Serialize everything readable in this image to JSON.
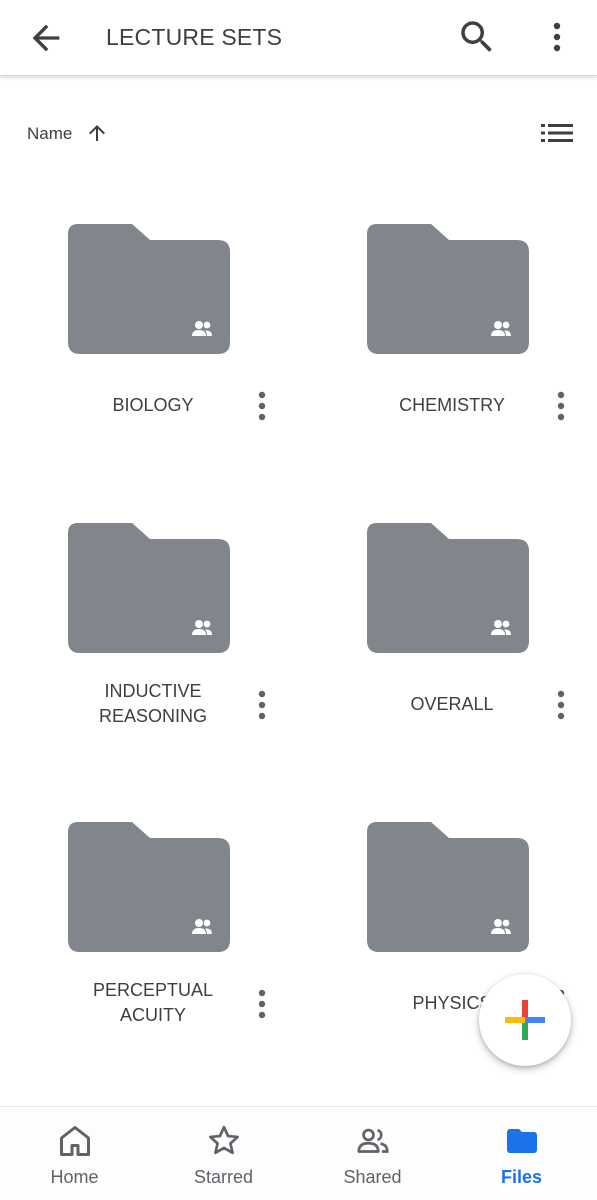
{
  "appbar": {
    "title": "LECTURE SETS",
    "back_icon": "arrow-back-icon",
    "search_icon": "search-icon",
    "more_icon": "more-vert-icon"
  },
  "sort": {
    "label": "Name",
    "direction_icon": "arrow-upward-icon",
    "view_icon": "list-view-icon"
  },
  "folders": [
    {
      "name_lines": [
        "BIOLOGY"
      ],
      "shared": true
    },
    {
      "name_lines": [
        "CHEMISTRY"
      ],
      "shared": true
    },
    {
      "name_lines": [
        "INDUCTIVE",
        "REASONING"
      ],
      "shared": true
    },
    {
      "name_lines": [
        "OVERALL"
      ],
      "shared": true
    },
    {
      "name_lines": [
        "PERCEPTUAL",
        "ACUITY"
      ],
      "shared": true
    },
    {
      "name_lines": [
        "PHYSICS"
      ],
      "shared": true
    }
  ],
  "colors": {
    "folder": "#80868b",
    "accent": "#1a73e8",
    "text": "#3c4043",
    "nav_inactive": "#5f6368"
  },
  "fab": {
    "icon": "add-plus-icon"
  },
  "bottom_nav": [
    {
      "label": "Home",
      "icon": "home-icon",
      "active": false
    },
    {
      "label": "Starred",
      "icon": "star-icon",
      "active": false
    },
    {
      "label": "Shared",
      "icon": "shared-people-icon",
      "active": false
    },
    {
      "label": "Files",
      "icon": "folder-icon",
      "active": true
    }
  ]
}
